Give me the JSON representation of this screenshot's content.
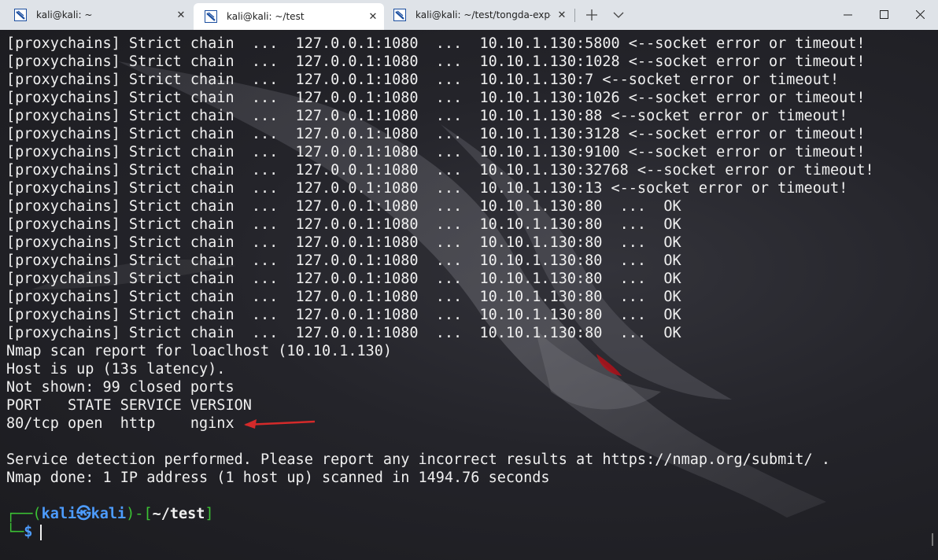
{
  "tabs": [
    {
      "title": "kali@kali: ~",
      "close": "✕"
    },
    {
      "title": "kali@kali: ~/test",
      "close": "✕"
    },
    {
      "title": "kali@kali: ~/test/tongda-exp-pc",
      "close": "✕"
    }
  ],
  "controls": {
    "new_tab": "+",
    "minimize": "–",
    "maximize": "□",
    "close": "✕"
  },
  "terminal": {
    "lines": [
      "[proxychains] Strict chain  ...  127.0.0.1:1080  ...  10.10.1.130:5800 <--socket error or timeout!",
      "[proxychains] Strict chain  ...  127.0.0.1:1080  ...  10.10.1.130:1028 <--socket error or timeout!",
      "[proxychains] Strict chain  ...  127.0.0.1:1080  ...  10.10.1.130:7 <--socket error or timeout!",
      "[proxychains] Strict chain  ...  127.0.0.1:1080  ...  10.10.1.130:1026 <--socket error or timeout!",
      "[proxychains] Strict chain  ...  127.0.0.1:1080  ...  10.10.1.130:88 <--socket error or timeout!",
      "[proxychains] Strict chain  ...  127.0.0.1:1080  ...  10.10.1.130:3128 <--socket error or timeout!",
      "[proxychains] Strict chain  ...  127.0.0.1:1080  ...  10.10.1.130:9100 <--socket error or timeout!",
      "[proxychains] Strict chain  ...  127.0.0.1:1080  ...  10.10.1.130:32768 <--socket error or timeout!",
      "[proxychains] Strict chain  ...  127.0.0.1:1080  ...  10.10.1.130:13 <--socket error or timeout!",
      "[proxychains] Strict chain  ...  127.0.0.1:1080  ...  10.10.1.130:80  ...  OK",
      "[proxychains] Strict chain  ...  127.0.0.1:1080  ...  10.10.1.130:80  ...  OK",
      "[proxychains] Strict chain  ...  127.0.0.1:1080  ...  10.10.1.130:80  ...  OK",
      "[proxychains] Strict chain  ...  127.0.0.1:1080  ...  10.10.1.130:80  ...  OK",
      "[proxychains] Strict chain  ...  127.0.0.1:1080  ...  10.10.1.130:80  ...  OK",
      "[proxychains] Strict chain  ...  127.0.0.1:1080  ...  10.10.1.130:80  ...  OK",
      "[proxychains] Strict chain  ...  127.0.0.1:1080  ...  10.10.1.130:80  ...  OK",
      "[proxychains] Strict chain  ...  127.0.0.1:1080  ...  10.10.1.130:80  ...  OK",
      "Nmap scan report for loaclhost (10.10.1.130)",
      "Host is up (13s latency).",
      "Not shown: 99 closed ports",
      "PORT   STATE SERVICE VERSION",
      "80/tcp open  http    nginx",
      "",
      "Service detection performed. Please report any incorrect results at https://nmap.org/submit/ .",
      "Nmap done: 1 IP address (1 host up) scanned in 1494.76 seconds",
      ""
    ],
    "prompt": {
      "corner_top": "┌──(",
      "user": "kali㉿kali",
      "mid": ")-[",
      "path": "~/test",
      "end": "]",
      "corner_bottom": "└─",
      "symbol": "$"
    }
  },
  "colors": {
    "arrow": "#d42a2a",
    "prompt_green": "#3bc234",
    "prompt_blue": "#4d9cff"
  }
}
